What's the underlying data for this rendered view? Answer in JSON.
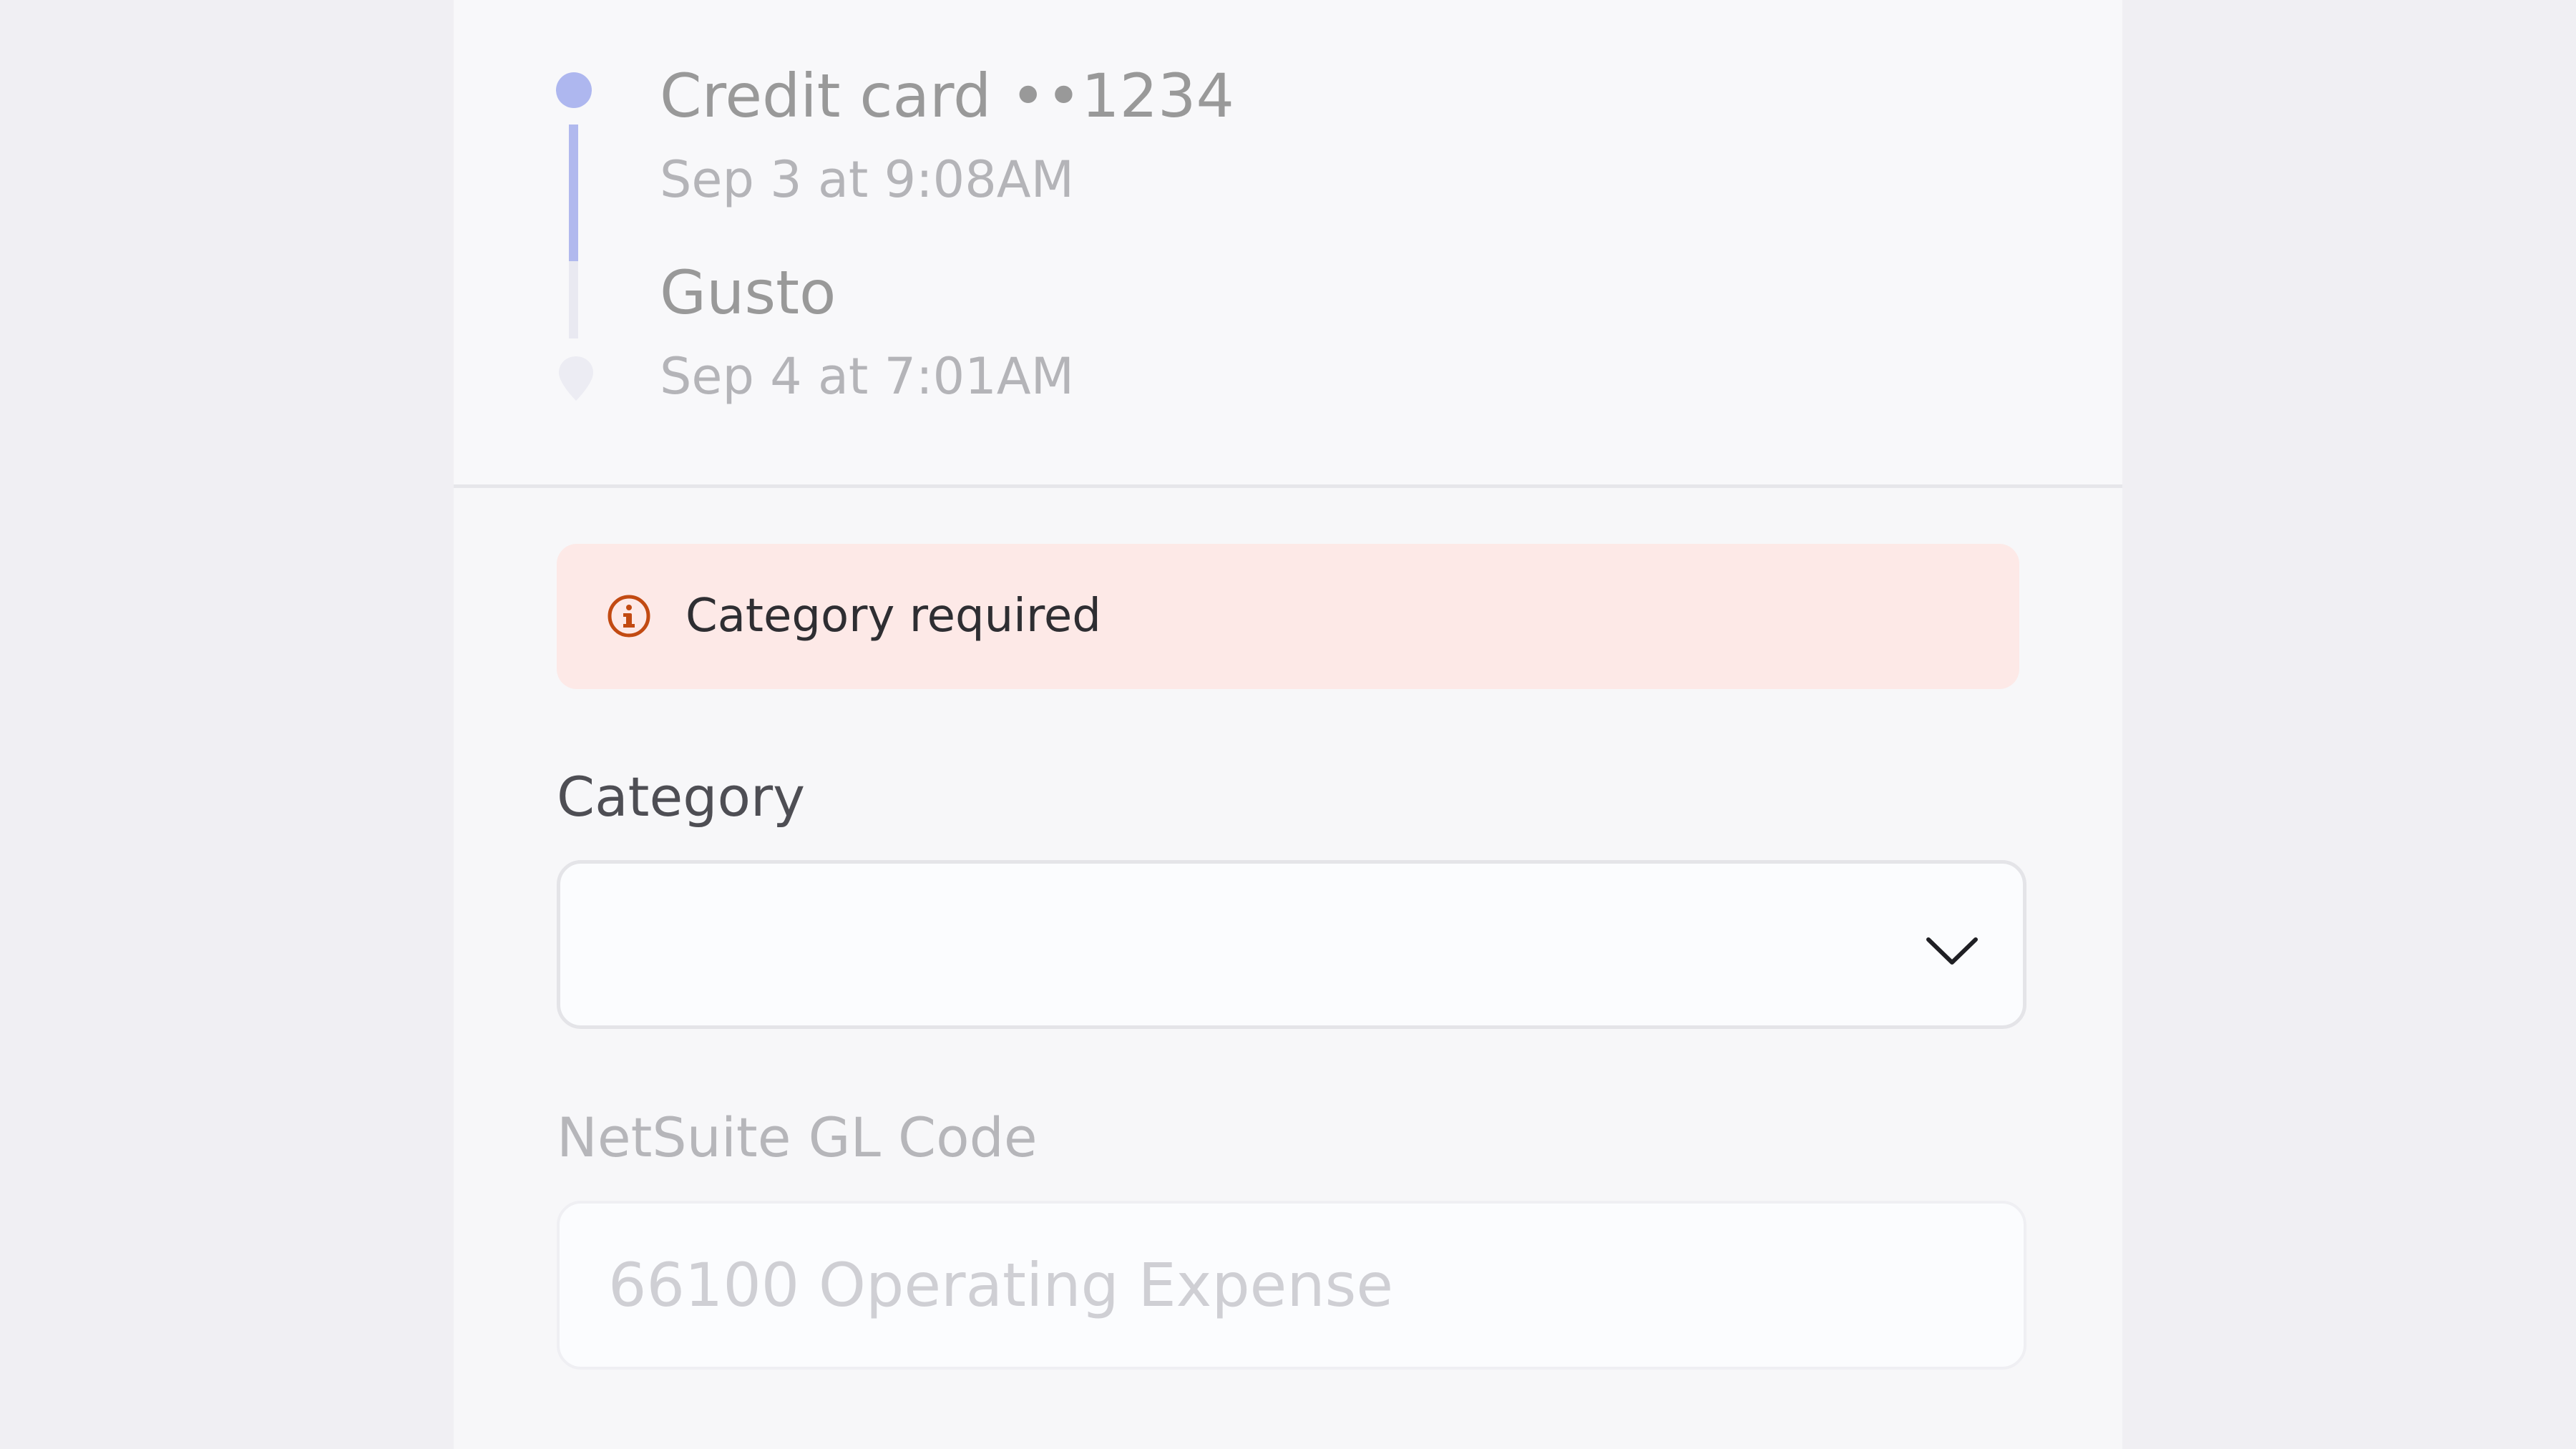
{
  "timeline": {
    "origin": {
      "title": "Credit card ••1234",
      "time": "Sep 3 at 9:08AM"
    },
    "destination": {
      "title": "Gusto",
      "time": "Sep 4 at 7:01AM"
    },
    "progress_fraction": 0.64
  },
  "alert": {
    "message": "Category required",
    "icon": "info-icon",
    "color": "#c24a12",
    "background": "#fde9e7"
  },
  "category_field": {
    "label": "Category",
    "value": "",
    "icon": "chevron-down-icon"
  },
  "gl_code_field": {
    "label": "NetSuite GL Code",
    "placeholder": "66100 Operating Expense"
  },
  "colors": {
    "accent": "#aeb7ef",
    "page_background": "#f0eff3"
  }
}
